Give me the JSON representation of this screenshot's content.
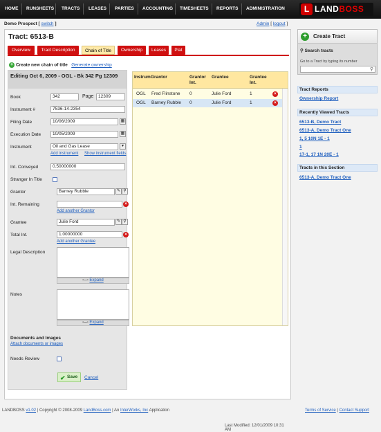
{
  "nav": {
    "items": [
      "HOME",
      "RUNSHEETS",
      "TRACTS",
      "LEASES",
      "PARTIES",
      "ACCOUNTING",
      "TIMESHEETS",
      "REPORTS",
      "ADMINISTRATION"
    ]
  },
  "logo": {
    "brand_a": "LAND",
    "brand_b": "BOSS"
  },
  "user": {
    "prospect_label": "Demo Prospect [",
    "switch_link": "switch",
    "close": " ]",
    "admin": "Admin",
    "sep": " [ ",
    "logout": "logout",
    "end": " ]"
  },
  "page": {
    "title": "Tract: 6513-B"
  },
  "tabs": [
    "Overview",
    "Tract Description",
    "Chain of Title",
    "Ownership",
    "Leases",
    "Plat"
  ],
  "active_tab": "Chain of Title",
  "chain": {
    "new_label": "Create new chain of title",
    "generate": "Generate ownership"
  },
  "form": {
    "header": "Editing Oct 6, 2009  -  OGL  -  Bk 342 Pg 12309",
    "book_label": "Book",
    "book": "342",
    "page_label": "Page",
    "page": "12309",
    "instrument_no_label": "Instrument #",
    "instrument_no": "7536-14-2354",
    "filing_label": "Filing Date",
    "filing": "10/06/2009",
    "exec_label": "Execution Date",
    "exec": "10/05/2009",
    "instrument_label": "Instrument",
    "instrument": "Oil and Gas Lease",
    "add_instrument": "Add instrument",
    "show_fields": "Show instrument fields",
    "int_conveyed_label": "Int. Conveyed",
    "int_conveyed": "0.50000000",
    "stranger_label": "Stranger In Title",
    "grantor_label": "Grantor",
    "grantor": "Barney Rubble",
    "int_remaining_label": "Int. Remaining",
    "int_remaining": "",
    "add_grantor": "Add another Grantor",
    "grantee_label": "Grantee",
    "grantee": "Julie Ford",
    "total_int_label": "Total Int.",
    "total_int": "1.00000000",
    "add_grantee": "Add another Grantee",
    "legal_label": "Legal Description",
    "expand": "Expand",
    "notes_label": "Notes",
    "docs_title": "Documents and Images",
    "attach": "Attach documents or images",
    "review_label": "Needs Review",
    "save": "Save",
    "cancel": "Cancel"
  },
  "grid": {
    "headers": [
      "Instrum",
      "Grantor",
      "Grantor Int.",
      "Grantee",
      "Grantee Int."
    ],
    "rows": [
      {
        "instrument": "OGL",
        "grantor": "Fred Flinstone",
        "grantor_int": "0",
        "grantee": "Julie Ford",
        "grantee_int": "1"
      },
      {
        "instrument": "OGL",
        "grantor": "Barney Rubble",
        "grantor_int": "0",
        "grantee": "Julie Ford",
        "grantee_int": "1"
      }
    ]
  },
  "last_modified": "Last Modified: 12/01/2009 10:31 AM",
  "sidebar": {
    "create": "Create Tract",
    "search_title": "Search tracts",
    "search_hint": "Go to a Tract by typing its number",
    "reports_title": "Tract Reports",
    "ownership_report": "Ownership Report",
    "recent_title": "Recently Viewed Tracts",
    "recent": [
      "6513-B, Demo Tract",
      "6513-A, Demo Tract One",
      "1, 5 10N 1E - 1",
      "1",
      "17-1, 17 1N 20E - 1"
    ],
    "section_title": "Tracts in this Section",
    "section": [
      "6513-A, Demo Tract One"
    ]
  },
  "footer": {
    "prefix": "LANDBOSS ",
    "version": "v1.02",
    "copy": " | Copyright © 2008-2009 ",
    "site": "LandBoss.com",
    "an": " | An ",
    "company": "InterWorks, Inc",
    "app": " Application",
    "terms": "Terms of Service",
    "bar": " | ",
    "contact": "Contact Support"
  }
}
